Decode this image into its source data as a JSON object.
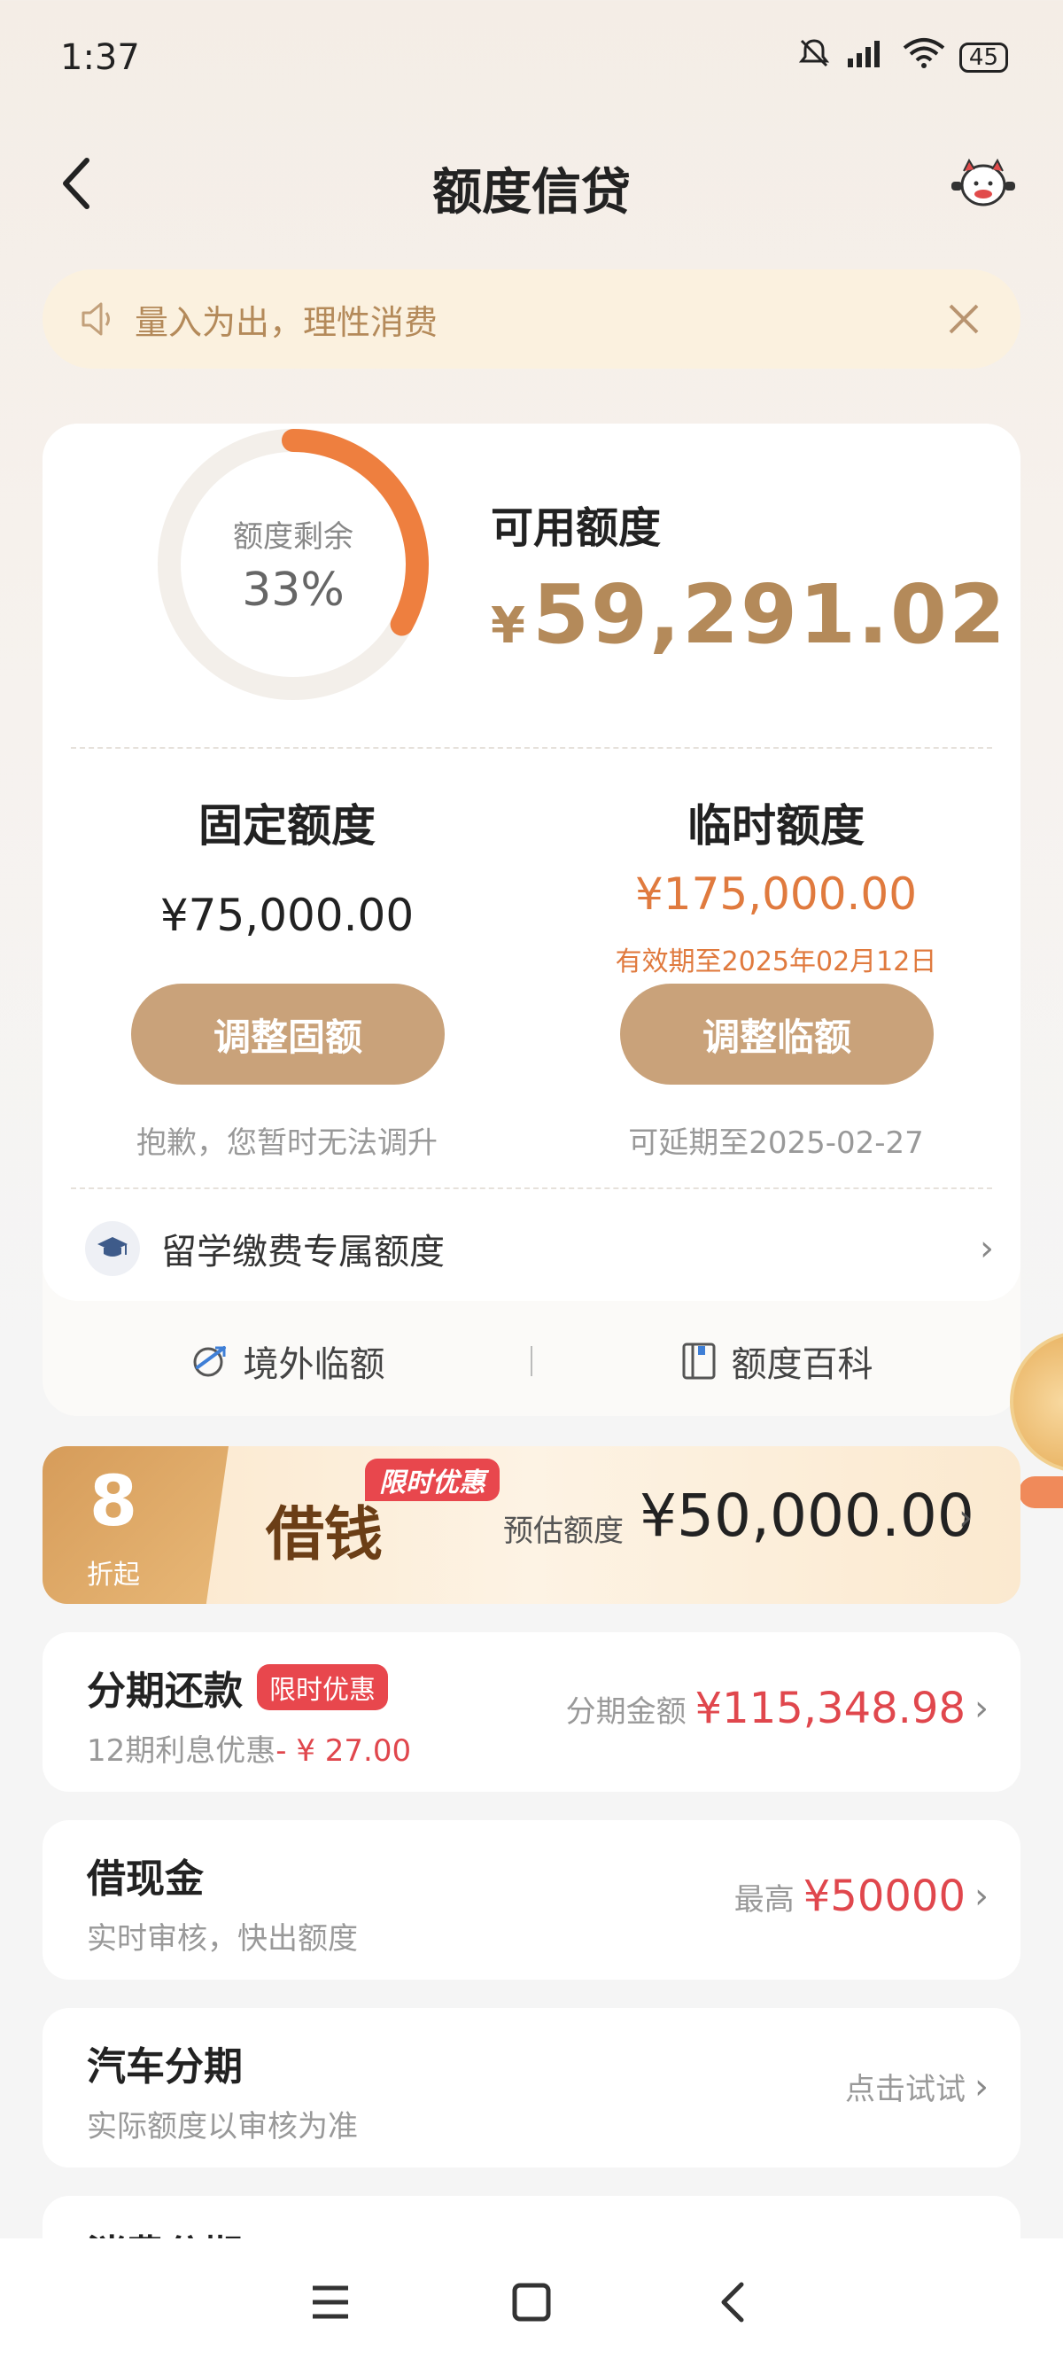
{
  "status_bar": {
    "time": "1:37",
    "battery": "45"
  },
  "header": {
    "title": "额度信贷"
  },
  "notice": {
    "text": "量入为出，理性消费"
  },
  "credit_summary": {
    "ring_label": "额度剩余",
    "ring_percent": "33%",
    "remaining_fraction": 0.33,
    "available_label": "可用额度",
    "available_currency": "¥",
    "available_amount": "59,291.02"
  },
  "fixed": {
    "title": "固定额度",
    "amount": "¥75,000.00",
    "button": "调整固额",
    "note": "抱歉，您暂时无法调升"
  },
  "temporary": {
    "title": "临时额度",
    "amount": "¥175,000.00",
    "valid": "有效期至2025年02月12日",
    "button": "调整临额",
    "note": "可延期至2025-02-27"
  },
  "study": {
    "label": "留学缴费专属额度"
  },
  "links": {
    "overseas": "境外临额",
    "wiki": "额度百科"
  },
  "banner": {
    "discount": "8",
    "discount_unit": "折起",
    "title": "借钱",
    "tag": "限时优惠",
    "estimate_label": "预估额度",
    "estimate_amount": "¥50,000.00"
  },
  "installment": {
    "title": "分期还款",
    "tag": "限时优惠",
    "sub": "12期利息优惠",
    "sub_discount": "- ¥ 27.00",
    "right_label": "分期金额",
    "right_value": "¥115,348.98"
  },
  "cash": {
    "title": "借现金",
    "sub": "实时审核，快出额度",
    "right_label": "最高",
    "right_value": "¥50000"
  },
  "car": {
    "title": "汽车分期",
    "sub": "实际额度以审核为准",
    "right_label": "点击试试"
  },
  "consumer": {
    "title": "消费分期"
  },
  "colors": {
    "accent": "#c9a27a",
    "orange": "#e07a3e",
    "red": "#e0474d",
    "ring": "#ee7f3f"
  }
}
